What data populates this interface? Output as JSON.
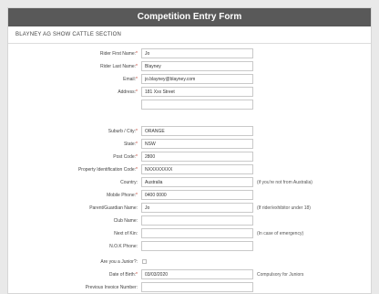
{
  "header": {
    "title": "Competition Entry Form"
  },
  "section": {
    "title": "BLAYNEY AG SHOW CATTLE SECTION"
  },
  "fields": {
    "first_name": {
      "label": "Rider First Name:",
      "value": "Jo"
    },
    "last_name": {
      "label": "Rider Last Name:",
      "value": "Blayney"
    },
    "email": {
      "label": "Email:",
      "value": "jo.blayney@blayney.com"
    },
    "address": {
      "label": "Address:",
      "value": "181 Xxx Street",
      "value2": ""
    },
    "suburb": {
      "label": "Suburb / City:",
      "value": "ORANGE"
    },
    "state": {
      "label": "State:",
      "value": "NSW"
    },
    "postcode": {
      "label": "Post Code:",
      "value": "2800"
    },
    "pic": {
      "label": "Property Identification Code:",
      "value": "NXXXXXXXX"
    },
    "country": {
      "label": "Country:",
      "value": "Australia",
      "hint": "(if you're not from Australia)"
    },
    "mobile": {
      "label": "Mobile Phone:",
      "value": "0400 0000"
    },
    "guardian": {
      "label": "Parent/Guardian Name:",
      "value": "Jo",
      "hint": "(If rider/exhibitor under 18)"
    },
    "club": {
      "label": "Club Name:",
      "value": ""
    },
    "nok": {
      "label": "Next of Kin:",
      "value": "",
      "hint": "(In case of emergency)"
    },
    "nok_phone": {
      "label": "N.O.K Phone:",
      "value": ""
    },
    "junior": {
      "label": "Are you a Junior?:"
    },
    "dob": {
      "label": "Date of Birth:",
      "value": "03/03/2020",
      "hint": "Compulsory for Juniors"
    },
    "invoice": {
      "label": "Previous Invoice Number:",
      "value": ""
    }
  },
  "required_marker": "*"
}
